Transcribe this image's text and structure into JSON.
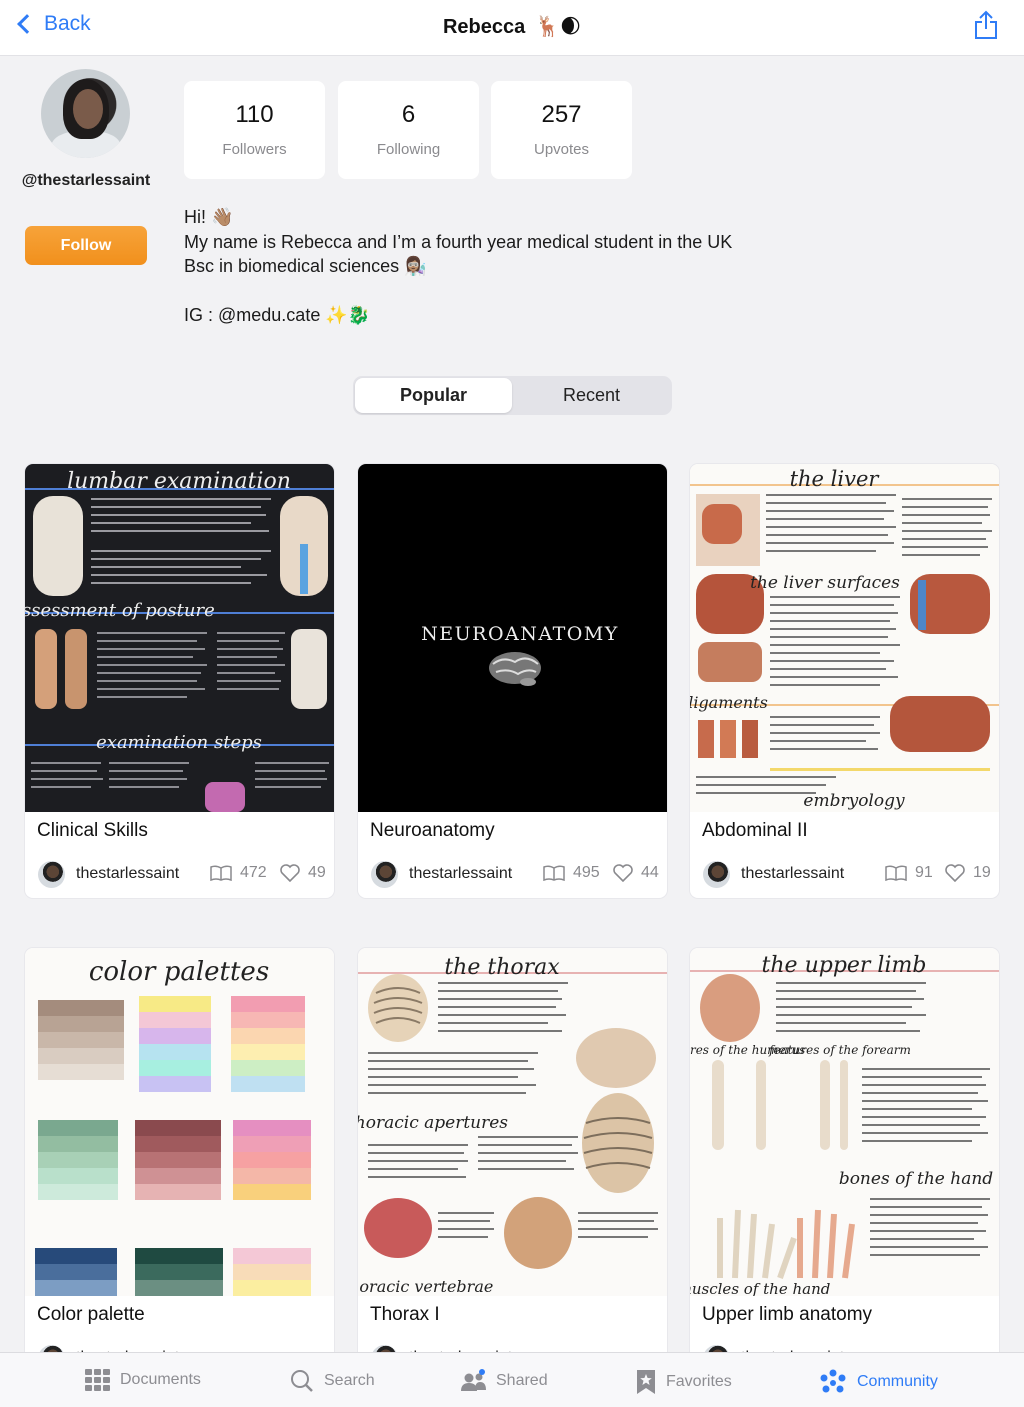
{
  "nav": {
    "back_label": "Back",
    "title": "Rebecca",
    "title_emoji": "🦌🌒"
  },
  "profile": {
    "handle": "@thestarlessaint",
    "follow_label": "Follow",
    "stats": [
      {
        "value": "110",
        "label": "Followers"
      },
      {
        "value": "6",
        "label": "Following"
      },
      {
        "value": "257",
        "label": "Upvotes"
      }
    ],
    "bio": [
      "Hi! 👋🏽",
      "My name is Rebecca and I’m a fourth year medical student in the UK",
      "Bsc in biomedical sciences 👩🏽‍🔬",
      "",
      "IG : @medu.cate ✨🐉"
    ]
  },
  "segment": {
    "options": [
      "Popular",
      "Recent"
    ],
    "selected": "Popular"
  },
  "cards": [
    {
      "title": "Clinical Skills",
      "author": "thestarlessaint",
      "views": "472",
      "likes": "49",
      "thumb_heading": "lumbar examination",
      "thumb_sub1": "assessment of posture",
      "thumb_sub2": "examination steps"
    },
    {
      "title": "Neuroanatomy",
      "author": "thestarlessaint",
      "views": "495",
      "likes": "44",
      "thumb_heading": "Neuroanatomy"
    },
    {
      "title": "Abdominal II",
      "author": "thestarlessaint",
      "views": "91",
      "likes": "19",
      "thumb_heading": "the liver",
      "thumb_sub1": "the liver surfaces",
      "thumb_sub2": "ligaments",
      "thumb_sub3": "embryology"
    },
    {
      "title": "Color palette",
      "author": "thestarlessaint",
      "views": "",
      "likes": "",
      "thumb_heading": "color palettes"
    },
    {
      "title": "Thorax I",
      "author": "thestarlessaint",
      "views": "",
      "likes": "",
      "thumb_heading": "the thorax",
      "thumb_sub1": "thoracic apertures",
      "thumb_sub2": "thoracic vertebrae"
    },
    {
      "title": "Upper limb anatomy",
      "author": "thestarlessaint",
      "views": "",
      "likes": "",
      "thumb_heading": "the upper limb",
      "thumb_sub1": "features of the humerus",
      "thumb_sub2": "features of the forearm",
      "thumb_sub3": "bones of the hand",
      "thumb_sub4": "muscles of the hand"
    }
  ],
  "tabbar": {
    "items": [
      "Documents",
      "Search",
      "Shared",
      "Favorites",
      "Community"
    ],
    "active": "Community"
  },
  "colors": {
    "accent": "#2f7cf6",
    "follow": "#f39a25"
  }
}
